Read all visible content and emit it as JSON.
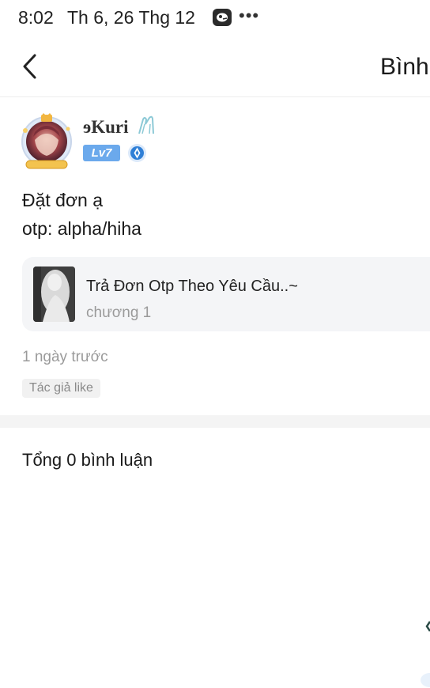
{
  "status_bar": {
    "time": "8:02",
    "date": "Th 6, 26 Thg 12",
    "more": "•••"
  },
  "header": {
    "title": "Bình"
  },
  "post": {
    "username": "ɘKuri",
    "level": "Lv7",
    "text_lines": [
      "Đặt đơn ạ",
      "otp: alpha/hiha"
    ],
    "story_card": {
      "title": "Trả Đơn Otp Theo Yêu Cầu..~",
      "chapter": "chương 1"
    },
    "time_ago": "1 ngày trước",
    "author_like_tag": "Tác giả like"
  },
  "comments": {
    "total_label": "Tổng 0 bình luận"
  },
  "colors": {
    "level_badge": "#6ba9ec",
    "vip_icon": "#2f7fd6",
    "card_bg": "#f4f5f7",
    "muted_text": "#9a9a9a"
  },
  "icons": {
    "back": "chevron-left-icon",
    "vip": "diamond-badge-icon",
    "username_deco": "ribbon-icon",
    "status_app": "app-notification-icon",
    "status_more": "more-dots-icon"
  }
}
